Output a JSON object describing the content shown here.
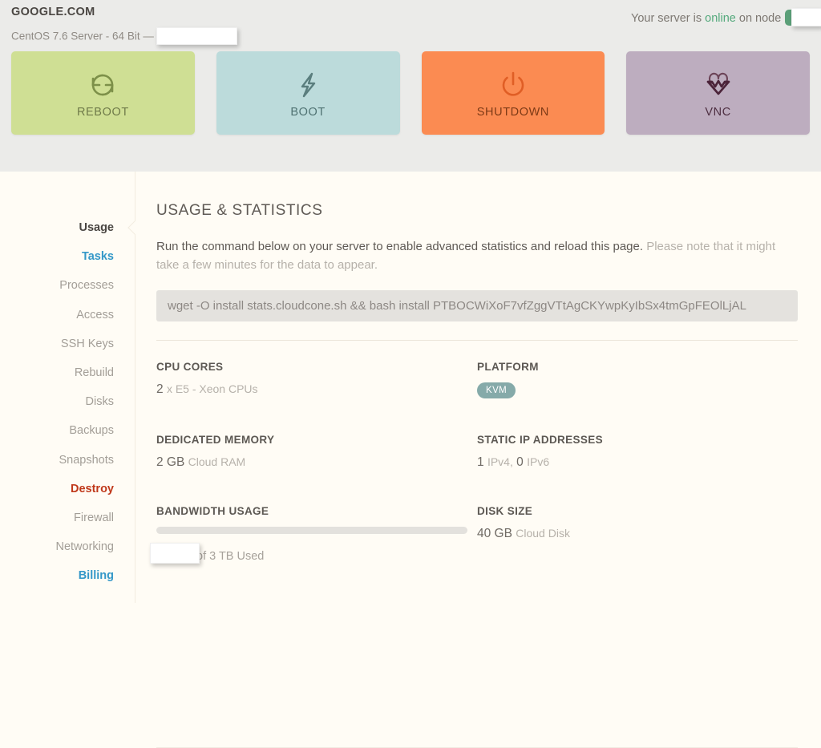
{
  "header": {
    "site_title": "GOOGLE.COM",
    "os_line": "CentOS 7.6 Server - 64 Bit —",
    "status_prefix": "Your server is",
    "status_value": "online",
    "status_suffix": "on node",
    "node_badge": "",
    "colors": {
      "header_bg": "#ebebe9",
      "status_green": "#54a97c",
      "badge_green": "#5b9f78"
    }
  },
  "actions": [
    {
      "label": "REBOOT",
      "icon": "refresh-icon",
      "bg": "#cfdf94",
      "fg": "#6f7a49"
    },
    {
      "label": "BOOT",
      "icon": "lightning-bolt-icon",
      "bg": "#bcdbdb",
      "fg": "#4f7272"
    },
    {
      "label": "SHUTDOWN",
      "icon": "power-icon",
      "bg": "#fb8b52",
      "fg": "#7d3a16"
    },
    {
      "label": "VNC",
      "icon": "heart-pulse-icon",
      "bg": "#bdadbf",
      "fg": "#4e2f42"
    }
  ],
  "sidebar": {
    "items": [
      {
        "label": "Usage",
        "state": "active"
      },
      {
        "label": "Tasks",
        "state": "accent-blue"
      },
      {
        "label": "Processes",
        "state": "normal"
      },
      {
        "label": "Access",
        "state": "normal"
      },
      {
        "label": "SSH Keys",
        "state": "normal"
      },
      {
        "label": "Rebuild",
        "state": "normal"
      },
      {
        "label": "Disks",
        "state": "normal"
      },
      {
        "label": "Backups",
        "state": "normal"
      },
      {
        "label": "Snapshots",
        "state": "normal"
      },
      {
        "label": "Destroy",
        "state": "accent-red"
      },
      {
        "label": "Firewall",
        "state": "normal"
      },
      {
        "label": "Networking",
        "state": "normal"
      },
      {
        "label": "Billing",
        "state": "accent-blue"
      }
    ]
  },
  "main": {
    "page_title": "USAGE & STATISTICS",
    "intro_strong": "Run the command below on your server to enable advanced statistics and reload this page.",
    "intro_muted": "Please note that it might take a few minutes for the data to appear.",
    "command": "wget -O install stats.cloudcone.sh && bash install PTBOCWiXoF7vfZggVTtAgCKYwpKyIbSx4tmGpFEOlLjAL",
    "stats": {
      "cpu_cores": {
        "label": "CPU CORES",
        "value": "2",
        "unit": "x E5 - Xeon CPUs"
      },
      "platform": {
        "label": "PLATFORM",
        "badge": "KVM",
        "badge_color": "#85aaa9"
      },
      "memory": {
        "label": "DEDICATED MEMORY",
        "value": "2 GB",
        "unit": "Cloud RAM"
      },
      "static_ips": {
        "label": "STATIC IP ADDRESSES",
        "ipv4_count": "1",
        "ipv4_unit": "IPv4,",
        "ipv6_count": "0",
        "ipv6_unit": "IPv6"
      },
      "bandwidth": {
        "label": "BANDWIDTH USAGE",
        "percent": 0,
        "text_tail": "of 3 TB Used",
        "used": ""
      },
      "disk": {
        "label": "DISK SIZE",
        "value": "40 GB",
        "unit": "Cloud Disk"
      }
    }
  }
}
